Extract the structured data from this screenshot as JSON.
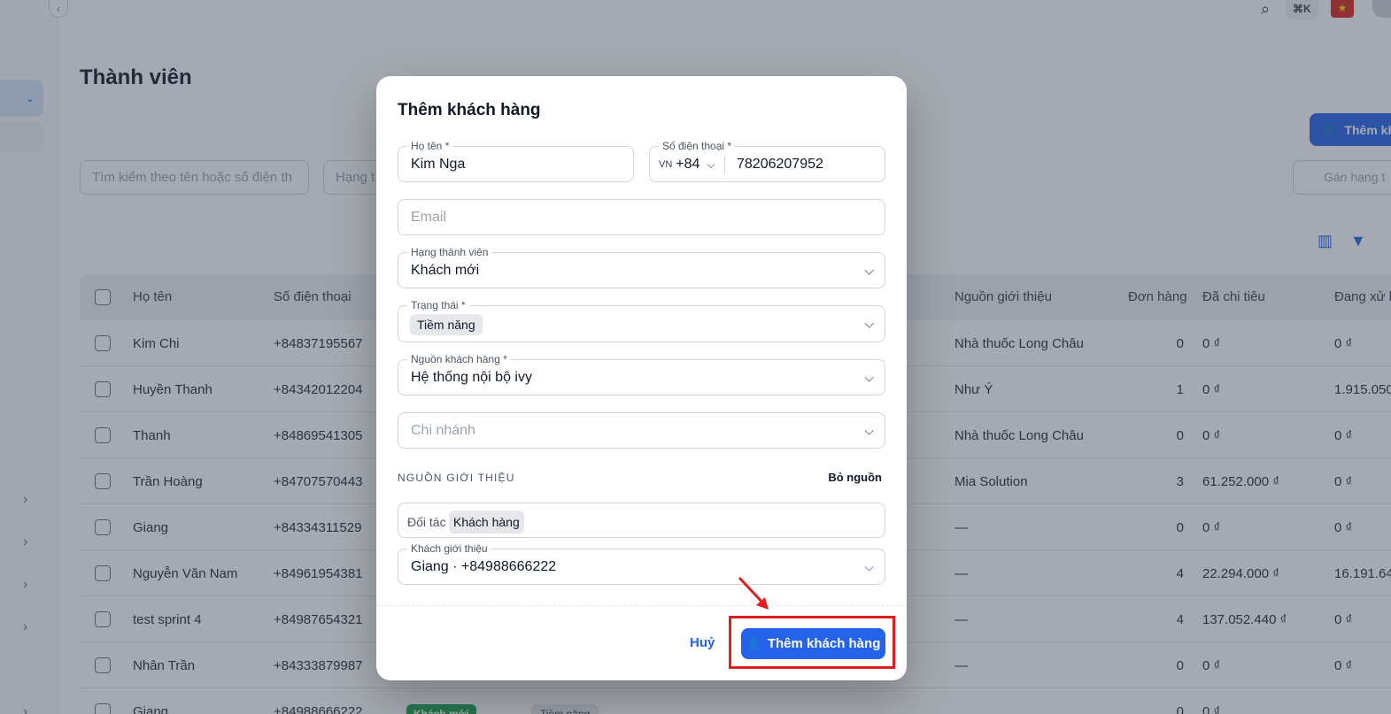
{
  "page": {
    "title": "Thành viên",
    "add_button": "Thêm kh",
    "search_placeholder": "Tìm kiếm theo tên hoặc số điện th",
    "rank_filter_placeholder": "Hạng t",
    "assign_rank": "Gán hạng t",
    "kbd_shortcut": "⌘K"
  },
  "table": {
    "headers": [
      "Họ tên",
      "Số điện thoại",
      "Nguồn giới thiệu",
      "Đơn hàng",
      "Đã chi tiêu",
      "Đang xử l"
    ],
    "rows": [
      {
        "name": "Kim Chi",
        "phone": "+84837195567",
        "source": "Nhà thuốc Long Châu",
        "orders": "0",
        "spent": "0 ₫",
        "processing": "0 ₫"
      },
      {
        "name": "Huyền Thanh",
        "phone": "+84342012204",
        "source": "Như Ý",
        "orders": "1",
        "spent": "0 ₫",
        "processing": "1.915.050"
      },
      {
        "name": "Thanh",
        "phone": "+84869541305",
        "source": "Nhà thuốc Long Châu",
        "orders": "0",
        "spent": "0 ₫",
        "processing": "0 ₫"
      },
      {
        "name": "Trần Hoàng",
        "phone": "+84707570443",
        "source": "Mia Solution",
        "orders": "3",
        "spent": "61.252.000 ₫",
        "processing": "0 ₫"
      },
      {
        "name": "Giang",
        "phone": "+84334311529",
        "source": "—",
        "orders": "0",
        "spent": "0 ₫",
        "processing": "0 ₫"
      },
      {
        "name": "Nguyễn Văn Nam",
        "phone": "+84961954381",
        "source": "—",
        "orders": "4",
        "spent": "22.294.000 ₫",
        "processing": "16.191.64"
      },
      {
        "name": "test sprint 4",
        "phone": "+84987654321",
        "source": "—",
        "orders": "4",
        "spent": "137.052.440 ₫",
        "processing": "0 ₫"
      },
      {
        "name": "Nhân Trần",
        "phone": "+84333879987",
        "source": "—",
        "orders": "0",
        "spent": "0 ₫",
        "processing": "0 ₫"
      },
      {
        "name": "Giang",
        "phone": "+84988666222",
        "source": "",
        "orders": "0",
        "spent": "0 ₫",
        "processing": "",
        "tag_rank": "Khách mới",
        "tag_status": "Tiềm năng"
      }
    ]
  },
  "modal": {
    "title": "Thêm khách hàng",
    "name_label": "Họ tên *",
    "name_value": "Kim Nga",
    "phone_label": "Số điện thoại *",
    "country_code": "VN",
    "dial_code": "+84",
    "phone_value": "78206207952",
    "email_placeholder": "Email",
    "rank_label": "Hạng thành viên",
    "rank_value": "Khách mới",
    "status_label": "Trạng thái *",
    "status_value": "Tiềm năng",
    "source_label": "Nguồn khách hàng *",
    "source_value": "Hệ thống nội bộ ivy",
    "branch_placeholder": "Chi nhánh",
    "referral_section": "NGUỒN GIỚI THIỆU",
    "remove_source": "Bỏ nguồn",
    "referral_type_partner": "Đối tác",
    "referral_type_customer": "Khách hàng",
    "referrer_label": "Khách giới thiệu",
    "referrer_value": "Giang · +84988666222",
    "cancel_label": "Huỷ",
    "submit_label": "Thêm khách hàng"
  },
  "colors": {
    "primary": "#2563eb",
    "highlight": "#e11d1d"
  }
}
